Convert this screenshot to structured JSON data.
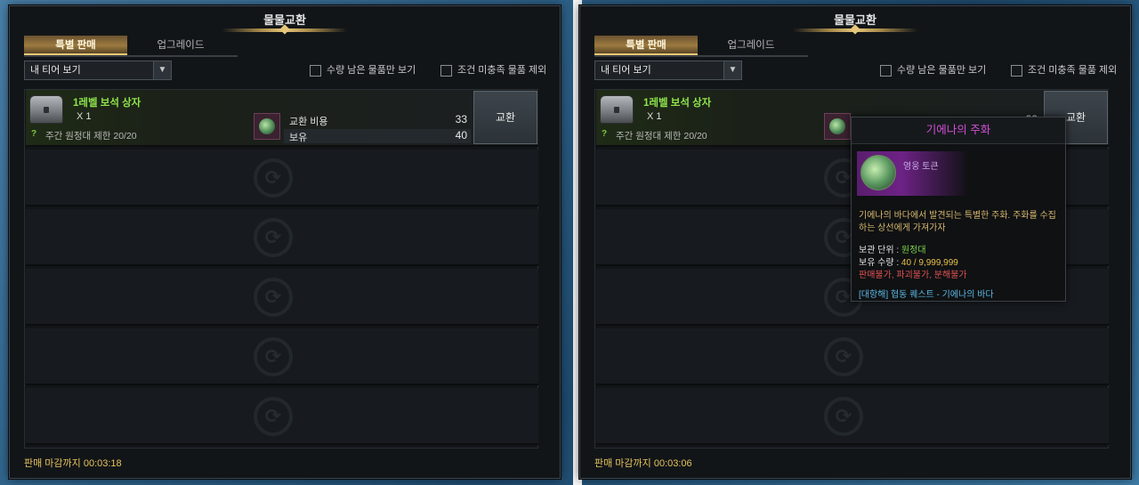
{
  "window_title": "물물교환",
  "tabs": [
    "특별 판매",
    "업그레이드"
  ],
  "dropdown": {
    "value": "내 티어 보기",
    "arrow_icon": "chevron-down-icon"
  },
  "checkboxes": [
    "수량 남은 물품만 보기",
    "조건 미충족 물품 제외"
  ],
  "item": {
    "name": "1레벨 보석 상자",
    "qty": "X 1",
    "limit_icon": "?",
    "limit": "주간 원정대 제한 20/20",
    "cost_label": "교환 비용",
    "cost_value": "33",
    "own_label": "보유",
    "own_value": "40",
    "exchange_label": "교환"
  },
  "panels": [
    {
      "deadline_label": "판매 마감까지",
      "deadline_time": "00:03:18"
    },
    {
      "deadline_label": "판매 마감까지",
      "deadline_time": "00:03:06"
    }
  ],
  "right_partial": {
    "cost_value_partial": "33"
  },
  "tooltip": {
    "title": "기에나의 주화",
    "type": "영웅 토큰",
    "description": "기에나의 바다에서 발견되는 특별한 주화. 주화를 수집하는 상선에게 가져가자",
    "bind_label": "보관 단위 :",
    "bind_value": "원정대",
    "own_label": "보유 수량 :",
    "own_value": "40 / 9,999,999",
    "restrict1": "판매불가",
    "restrict2": "파괴불가",
    "restrict3": "분해불가",
    "source": "[대항해] 협동 퀘스트 - 기에나의 바다"
  },
  "colors": {
    "accent_gold": "#e9c877",
    "item_green": "#8ee34c",
    "tooltip_title": "#d24fd8",
    "deadline": "#e5c35c"
  }
}
